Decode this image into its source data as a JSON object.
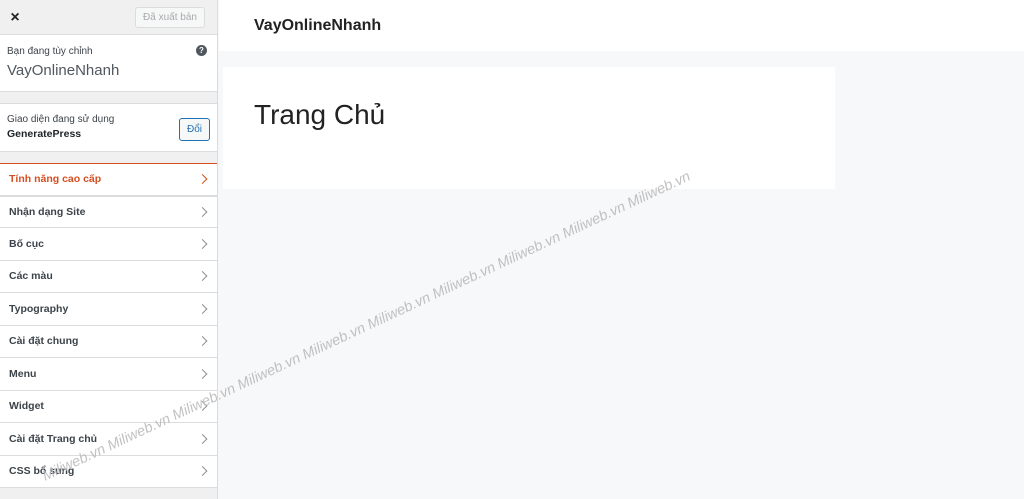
{
  "sidebar": {
    "close_label": "×",
    "publish_label": "Đã xuất bản",
    "customizing_label": "Bạn đang tùy chỉnh",
    "site_name": "VayOnlineNhanh",
    "help_icon": "?",
    "theme_label": "Giao diện đang sử dụng",
    "theme_name": "GeneratePress",
    "change_label": "Đổi",
    "menu": [
      {
        "label": "Tính năng cao cấp"
      },
      {
        "label": "Nhận dạng Site"
      },
      {
        "label": "Bố cục"
      },
      {
        "label": "Các màu"
      },
      {
        "label": "Typography"
      },
      {
        "label": "Cài đặt chung"
      },
      {
        "label": "Menu"
      },
      {
        "label": "Widget"
      },
      {
        "label": "Cài đặt Trang chủ"
      },
      {
        "label": "CSS bổ sung"
      }
    ]
  },
  "preview": {
    "site_title": "VayOnlineNhanh",
    "page_title": "Trang Chủ"
  },
  "watermark": "Miliweb.vn Miliweb.vn Miliweb.vn Miliweb.vn Miliweb.vn Miliweb.vn Miliweb.vn Miliweb.vn Miliweb.vn Miliweb.vn",
  "colors": {
    "accent": "#d54e21",
    "link": "#2271b1"
  }
}
